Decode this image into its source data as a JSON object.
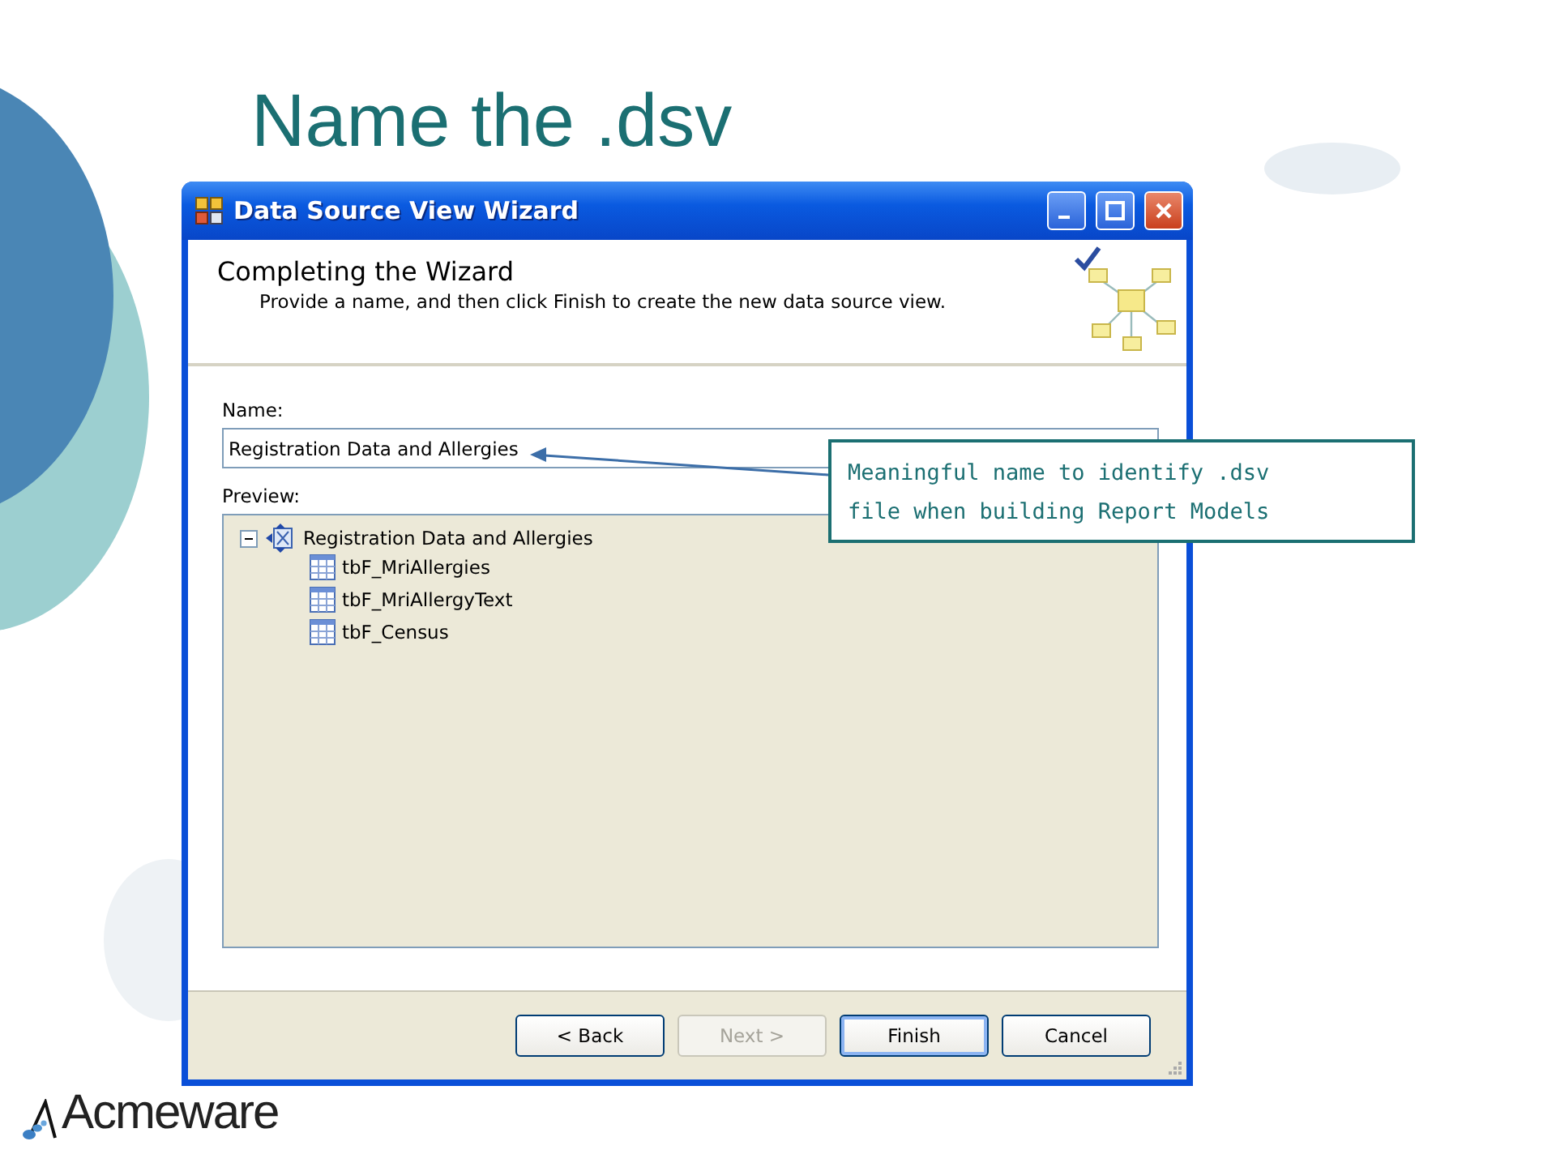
{
  "slide_title": "Name the .dsv",
  "window": {
    "title": "Data Source View Wizard",
    "header": {
      "title": "Completing the Wizard",
      "subtitle": "Provide a name, and then click Finish to create the new data source view."
    },
    "name_label": "Name:",
    "name_value": "Registration Data and Allergies",
    "preview_label": "Preview:",
    "tree": [
      {
        "label": "Registration Data and Allergies",
        "expanded": true,
        "children": [
          {
            "label": "tbF_MriAllergies"
          },
          {
            "label": "tbF_MriAllergyText"
          },
          {
            "label": "tbF_Census"
          }
        ]
      }
    ],
    "buttons": [
      {
        "label": "< Back",
        "disabled": false,
        "default": false
      },
      {
        "label": "Next >",
        "disabled": true,
        "default": false
      },
      {
        "label": "Finish",
        "disabled": false,
        "default": true
      },
      {
        "label": "Cancel",
        "disabled": false,
        "default": false
      }
    ]
  },
  "callout": {
    "text": "Meaningful name to identify .dsv file when building Report Models"
  },
  "logo": {
    "text": "Acmeware"
  }
}
